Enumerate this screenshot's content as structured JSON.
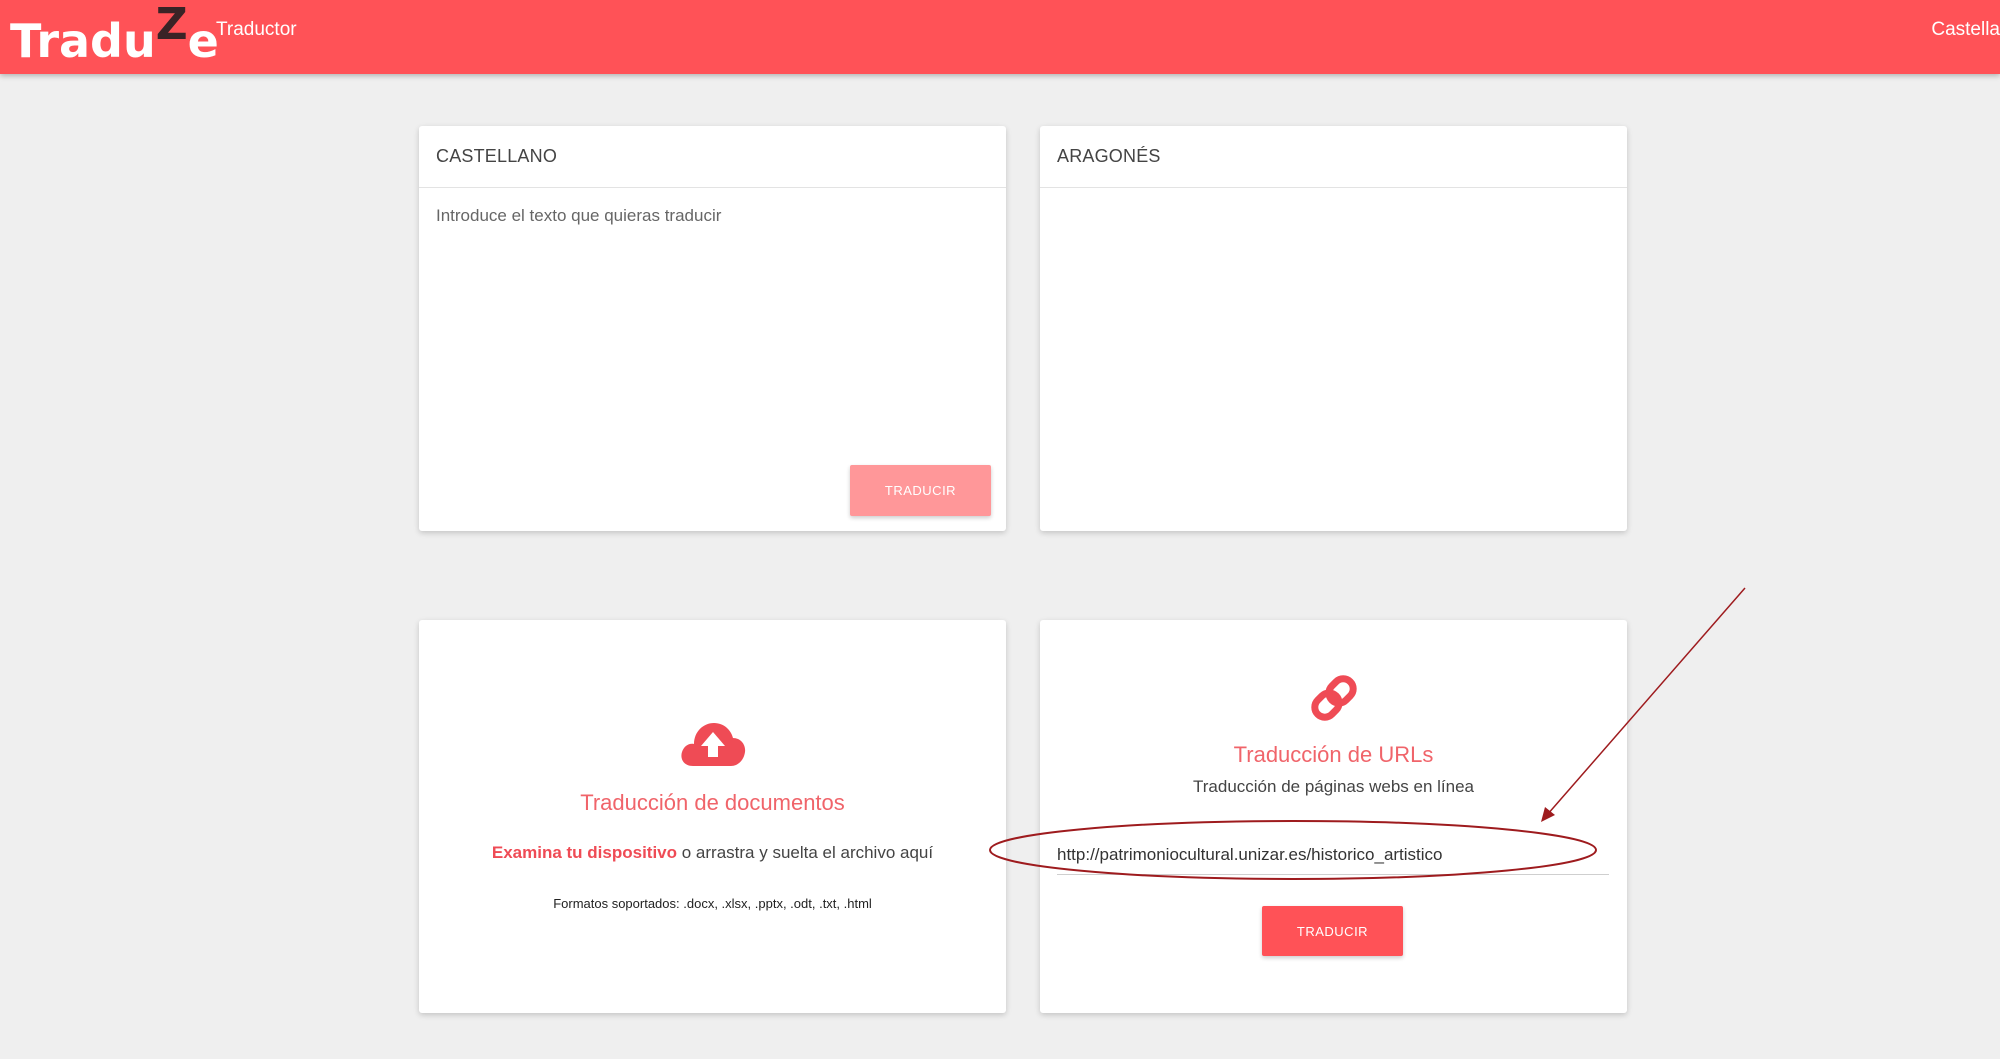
{
  "header": {
    "logo_prefix": "Tradu",
    "logo_z": "Z",
    "logo_suffix": "e",
    "nav_label": "Traductor",
    "language": "Castella",
    "bar_color": "#ff5257"
  },
  "source": {
    "language_label": "CASTELLANO",
    "placeholder": "Introduce el texto que quieras traducir",
    "translate_label": "TRADUCIR"
  },
  "target": {
    "language_label": "ARAGONÉS",
    "text": ""
  },
  "documents": {
    "icon": "cloud-upload-icon",
    "title": "Traducción de documentos",
    "browse_link": "Examina tu dispositivo",
    "drop_text": " o arrastra y suelta el archivo aquí",
    "formats": "Formatos soportados: .docx, .xlsx, .pptx, .odt, .txt, .html"
  },
  "urls": {
    "icon": "link-icon",
    "title": "Traducción de URLs",
    "subtitle": "Traducción de páginas webs en línea",
    "url_value": "http://patrimoniocultural.unizar.es/historico_artistico",
    "translate_label": "TRADUCIR"
  },
  "annotation": {
    "color": "#9e1b1e"
  }
}
